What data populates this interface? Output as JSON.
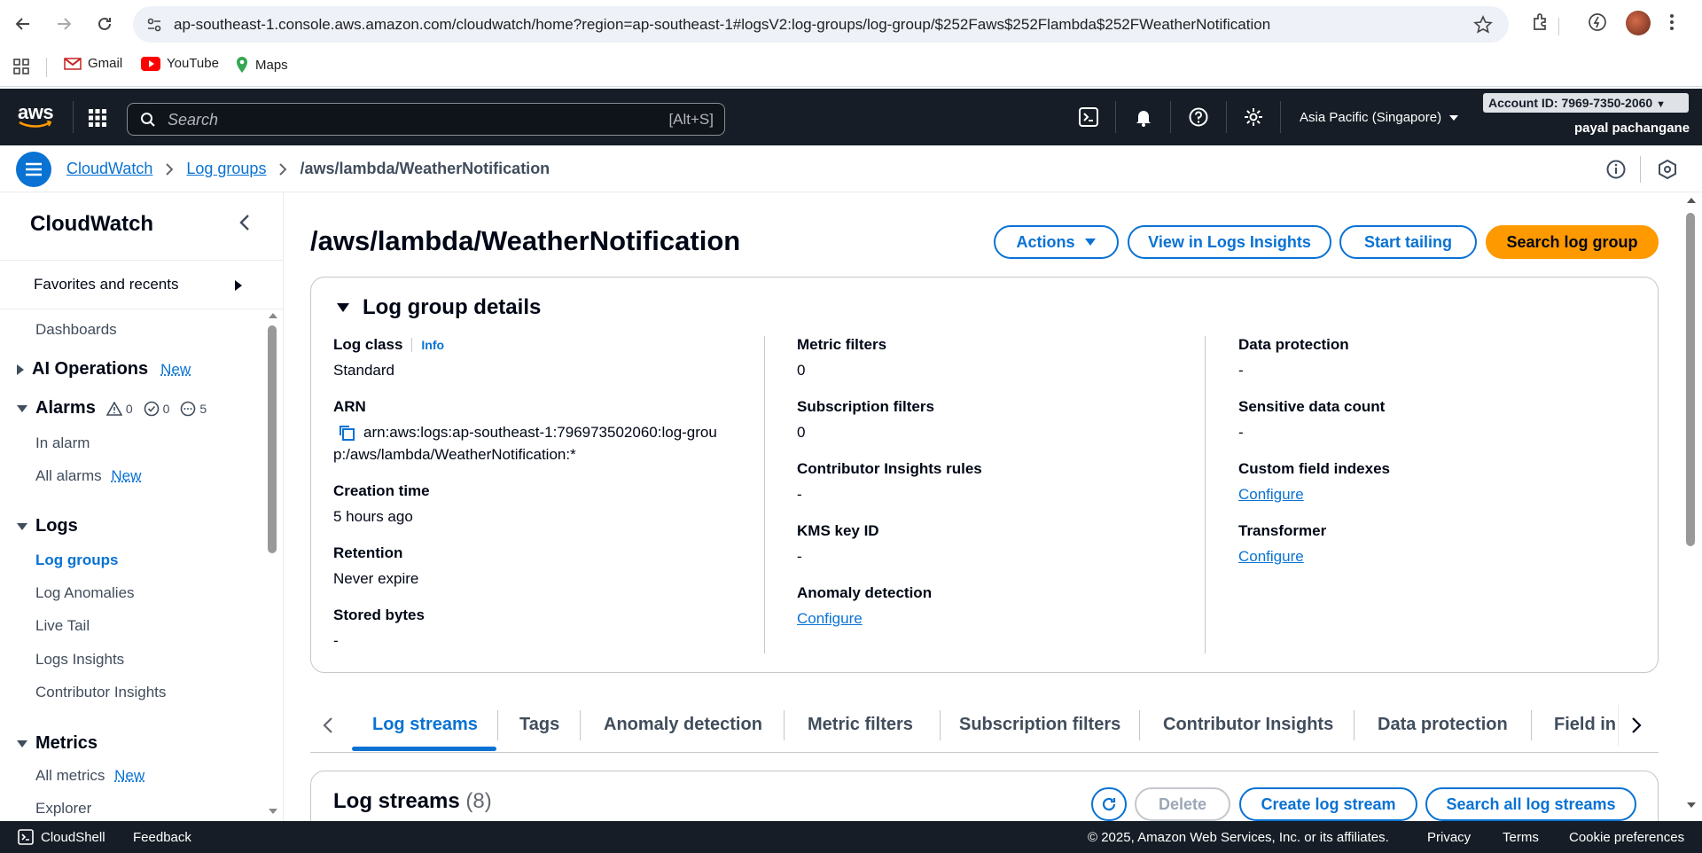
{
  "browser": {
    "url": "ap-southeast-1.console.aws.amazon.com/cloudwatch/home?region=ap-southeast-1#logsV2:log-groups/log-group/$252Faws$252Flambda$252FWeatherNotification",
    "bookmarks": [
      "Gmail",
      "YouTube",
      "Maps"
    ]
  },
  "header": {
    "logo": "aws",
    "search_placeholder": "Search",
    "search_shortcut": "[Alt+S]",
    "region": "Asia Pacific (Singapore)",
    "account": "Account ID: 7969-7350-2060",
    "user": "payal pachangane"
  },
  "breadcrumb": {
    "items": [
      "CloudWatch",
      "Log groups"
    ],
    "current": "/aws/lambda/WeatherNotification"
  },
  "sidebar": {
    "title": "CloudWatch",
    "favorites": "Favorites and recents",
    "dashboards": "Dashboards",
    "ai_operations": "AI Operations",
    "new_badge": "New",
    "alarms": "Alarms",
    "alarm_counts": [
      "0",
      "0",
      "5"
    ],
    "in_alarm": "In alarm",
    "all_alarms": "All alarms",
    "logs": "Logs",
    "log_items": [
      "Log groups",
      "Log Anomalies",
      "Live Tail",
      "Logs Insights",
      "Contributor Insights"
    ],
    "metrics": "Metrics",
    "all_metrics": "All metrics",
    "explorer": "Explorer"
  },
  "page": {
    "title": "/aws/lambda/WeatherNotification",
    "actions": "Actions",
    "view_insights": "View in Logs Insights",
    "start_tailing": "Start tailing",
    "search_log_group": "Search log group"
  },
  "details": {
    "heading": "Log group details",
    "info": "Info",
    "col1": [
      {
        "key": "Log class",
        "value": "Standard"
      },
      {
        "key": "ARN",
        "value": "arn:aws:logs:ap-southeast-1:796973502060:log-group:/aws/lambda/WeatherNotification:*"
      },
      {
        "key": "Creation time",
        "value": "5 hours ago"
      },
      {
        "key": "Retention",
        "value": "Never expire"
      },
      {
        "key": "Stored bytes",
        "value": "-"
      }
    ],
    "col2": [
      {
        "key": "Metric filters",
        "value": "0"
      },
      {
        "key": "Subscription filters",
        "value": "0"
      },
      {
        "key": "Contributor Insights rules",
        "value": "-"
      },
      {
        "key": "KMS key ID",
        "value": "-"
      },
      {
        "key": "Anomaly detection",
        "value": "Configure"
      }
    ],
    "col3": [
      {
        "key": "Data protection",
        "value": "-"
      },
      {
        "key": "Sensitive data count",
        "value": "-"
      },
      {
        "key": "Custom field indexes",
        "value": "Configure"
      },
      {
        "key": "Transformer",
        "value": "Configure"
      }
    ]
  },
  "tabs": [
    "Log streams",
    "Tags",
    "Anomaly detection",
    "Metric filters",
    "Subscription filters",
    "Contributor Insights",
    "Data protection",
    "Field in"
  ],
  "streams": {
    "title": "Log streams",
    "count": "(8)",
    "delete": "Delete",
    "create": "Create log stream",
    "search_all": "Search all log streams"
  },
  "footer": {
    "cloudshell": "CloudShell",
    "feedback": "Feedback",
    "copyright": "© 2025, Amazon Web Services, Inc. or its affiliates.",
    "privacy": "Privacy",
    "terms": "Terms",
    "cookies": "Cookie preferences"
  }
}
